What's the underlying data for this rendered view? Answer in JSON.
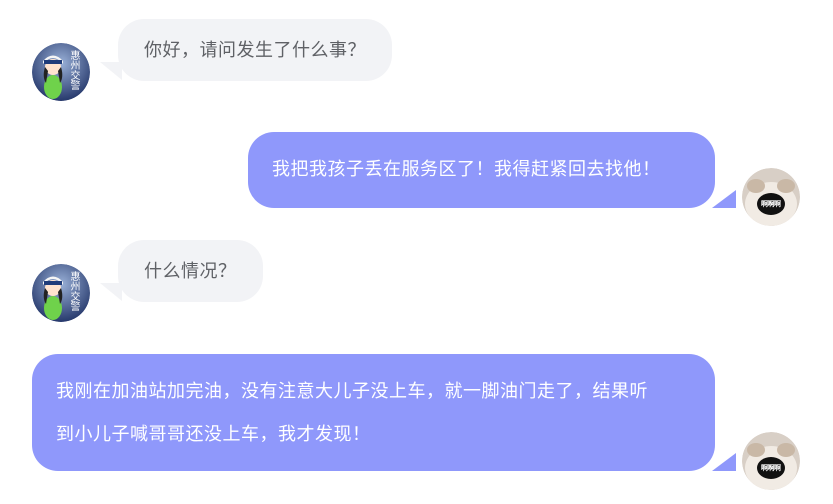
{
  "messages": [
    {
      "side": "left",
      "sender": "police",
      "text": "你好，请问发生了什么事？"
    },
    {
      "side": "right",
      "sender": "user",
      "text": "我把我孩子丢在服务区了！我得赶紧回去找他！"
    },
    {
      "side": "left",
      "sender": "police",
      "text": "什么情况？"
    },
    {
      "side": "right",
      "sender": "user",
      "text_lines": [
        "我刚在加油站加完油，没有注意大儿子没上车，就一脚油门走了，结果听",
        "到小儿子喊哥哥还没上车，我才发现！"
      ]
    }
  ],
  "avatars": {
    "police_badge_text": "惠州交警",
    "user_mouth_text": "啊啊啊"
  },
  "colors": {
    "left_bubble": "#f2f3f6",
    "right_bubble": "#8f98fb",
    "left_text": "#5f6166",
    "right_text": "#ffffff"
  }
}
